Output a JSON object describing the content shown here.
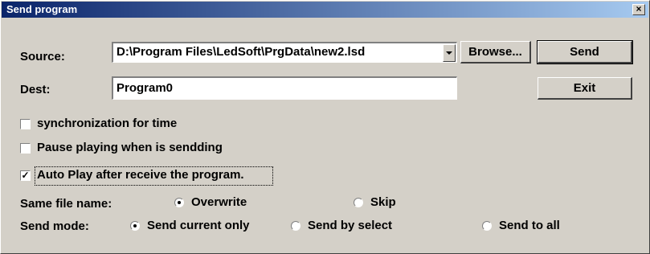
{
  "window": {
    "title": "Send program",
    "close_glyph": "×"
  },
  "source": {
    "label": "Source:",
    "value": "D:\\Program Files\\LedSoft\\PrgData\\new2.lsd"
  },
  "dest": {
    "label": "Dest:",
    "value": "Program0"
  },
  "buttons": {
    "browse": "Browse...",
    "send": "Send",
    "exit": "Exit"
  },
  "options": {
    "sync_time": {
      "label": "synchronization for time",
      "checked": false
    },
    "pause_playing": {
      "label": "Pause playing when is sendding",
      "checked": false
    },
    "auto_play": {
      "label": "Auto Play after receive the program.",
      "checked": true,
      "check_glyph": "✓"
    }
  },
  "same_file_name": {
    "label": "Same file name:",
    "options": [
      {
        "label": "Overwrite",
        "selected": true
      },
      {
        "label": "Skip",
        "selected": false
      }
    ]
  },
  "send_mode": {
    "label": "Send mode:",
    "options": [
      {
        "label": "Send current only",
        "selected": true
      },
      {
        "label": "Send by select",
        "selected": false
      },
      {
        "label": "Send to all",
        "selected": false
      }
    ]
  },
  "colors": {
    "titlebar_start": "#0a246a",
    "titlebar_end": "#a6caf0",
    "face": "#d4d0c8"
  }
}
